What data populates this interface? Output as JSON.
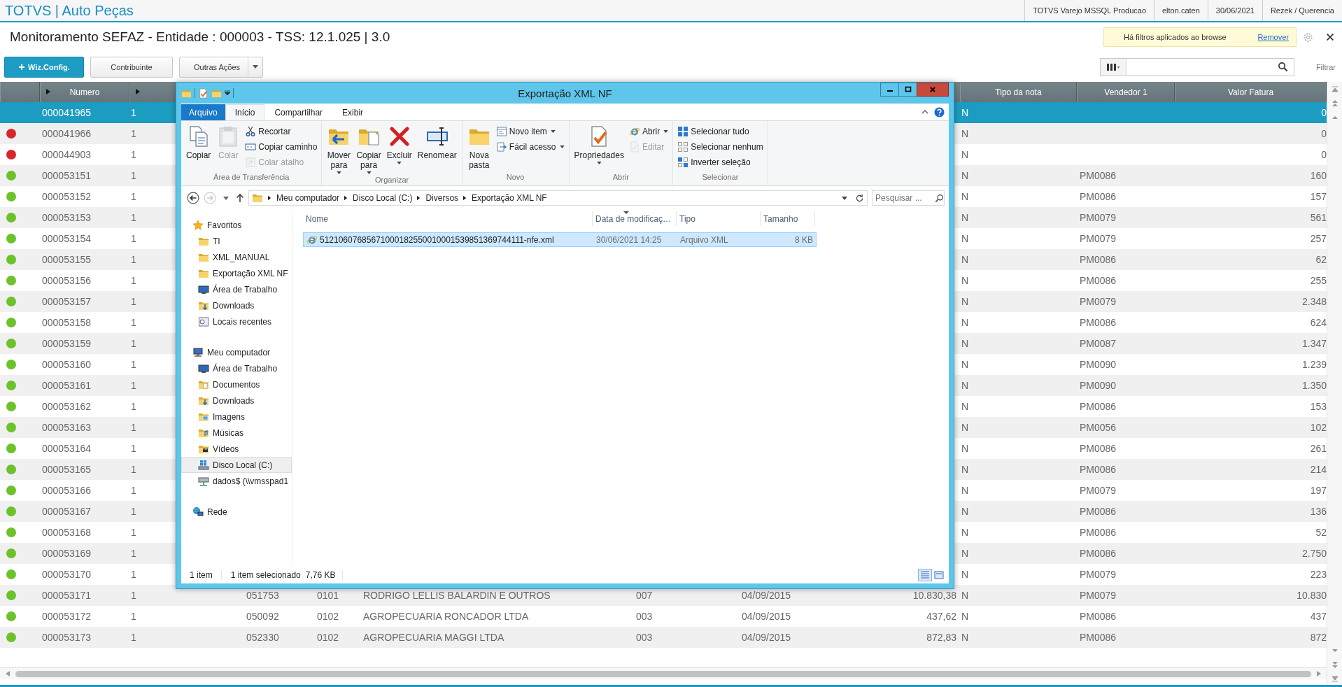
{
  "app": {
    "title": "TOTVS | Auto Peças",
    "status_items": [
      "TOTVS Varejo MSSQL Producao",
      "elton.caten",
      "30/06/2021",
      "Rezek / Querencia"
    ]
  },
  "page": {
    "title": "Monitoramento SEFAZ - Entidade : 000003 - TSS: 12.1.025 | 3.0",
    "filter_notice": {
      "text": "Há filtros aplicados ao browse",
      "link": "Remover"
    }
  },
  "toolbar": {
    "buttons": [
      {
        "label": "Wiz.Config.",
        "kind": "primary"
      },
      {
        "label": "Contribuinte",
        "kind": "plain"
      },
      {
        "label": "Outras Ações",
        "kind": "menu"
      }
    ],
    "filter_label": "Filtrar"
  },
  "table": {
    "columns": [
      {
        "label": "Numero"
      },
      {
        "label": "Tipo da nota"
      },
      {
        "label": "Vendedor 1"
      },
      {
        "label": "Valor Fatura"
      }
    ],
    "rows": [
      {
        "selected": true,
        "numero": "000041965",
        "column_3": "1",
        "tipo_da_nota": "N",
        "valor_fatura": "0"
      },
      {
        "selected": false,
        "color": "#d8262c",
        "numero": "000041966",
        "column_3": "1",
        "tipo_da_nota": "N",
        "valor_fatura": "0"
      },
      {
        "selected": false,
        "color": "#d8262c",
        "numero": "000044903",
        "column_3": "1",
        "tipo_da_nota": "N",
        "valor_fatura": "0"
      },
      {
        "selected": false,
        "color": "#6cc22a",
        "numero": "000053151",
        "column_3": "1",
        "tipo_da_nota": "N",
        "vendedor_1": "PM0086",
        "valor_fatura": "160"
      },
      {
        "selected": false,
        "color": "#6cc22a",
        "numero": "000053152",
        "column_3": "1",
        "tipo_da_nota": "N",
        "vendedor_1": "PM0086",
        "valor_fatura": "157"
      },
      {
        "selected": false,
        "color": "#6cc22a",
        "numero": "000053153",
        "column_3": "1",
        "tipo_da_nota": "N",
        "vendedor_1": "PM0079",
        "valor_fatura": "561"
      },
      {
        "selected": false,
        "color": "#6cc22a",
        "numero": "000053154",
        "column_3": "1",
        "tipo_da_nota": "N",
        "vendedor_1": "PM0079",
        "valor_fatura": "257"
      },
      {
        "selected": false,
        "color": "#6cc22a",
        "numero": "000053155",
        "column_3": "1",
        "tipo_da_nota": "N",
        "vendedor_1": "PM0086",
        "valor_fatura": "62"
      },
      {
        "selected": false,
        "color": "#6cc22a",
        "numero": "000053156",
        "column_3": "1",
        "tipo_da_nota": "N",
        "vendedor_1": "PM0086",
        "valor_fatura": "255"
      },
      {
        "selected": false,
        "color": "#6cc22a",
        "numero": "000053157",
        "column_3": "1",
        "tipo_da_nota": "N",
        "vendedor_1": "PM0079",
        "valor_fatura": "2.348"
      },
      {
        "selected": false,
        "color": "#6cc22a",
        "numero": "000053158",
        "column_3": "1",
        "tipo_da_nota": "N",
        "vendedor_1": "PM0086",
        "valor_fatura": "624"
      },
      {
        "selected": false,
        "color": "#6cc22a",
        "numero": "000053159",
        "column_3": "1",
        "tipo_da_nota": "N",
        "vendedor_1": "PM0087",
        "valor_fatura": "1.347"
      },
      {
        "selected": false,
        "color": "#6cc22a",
        "numero": "000053160",
        "column_3": "1",
        "tipo_da_nota": "N",
        "vendedor_1": "PM0090",
        "valor_fatura": "1.239"
      },
      {
        "selected": false,
        "color": "#6cc22a",
        "numero": "000053161",
        "column_3": "1",
        "tipo_da_nota": "N",
        "vendedor_1": "PM0090",
        "valor_fatura": "1.350"
      },
      {
        "selected": false,
        "color": "#6cc22a",
        "numero": "000053162",
        "column_3": "1",
        "tipo_da_nota": "N",
        "vendedor_1": "PM0086",
        "valor_fatura": "153"
      },
      {
        "selected": false,
        "color": "#6cc22a",
        "numero": "000053163",
        "column_3": "1",
        "tipo_da_nota": "N",
        "vendedor_1": "PM0056",
        "valor_fatura": "102"
      },
      {
        "selected": false,
        "color": "#6cc22a",
        "numero": "000053164",
        "column_3": "1",
        "tipo_da_nota": "N",
        "vendedor_1": "PM0086",
        "valor_fatura": "261"
      },
      {
        "selected": false,
        "color": "#6cc22a",
        "numero": "000053165",
        "column_3": "1",
        "tipo_da_nota": "N",
        "vendedor_1": "PM0086",
        "valor_fatura": "214"
      },
      {
        "selected": false,
        "color": "#6cc22a",
        "numero": "000053166",
        "column_3": "1",
        "tipo_da_nota": "N",
        "vendedor_1": "PM0079",
        "valor_fatura": "197"
      },
      {
        "selected": false,
        "color": "#6cc22a",
        "numero": "000053167",
        "column_3": "1",
        "tipo_da_nota": "N",
        "vendedor_1": "PM0086",
        "valor_fatura": "136"
      },
      {
        "selected": false,
        "color": "#6cc22a",
        "numero": "000053168",
        "column_3": "1",
        "tipo_da_nota": "N",
        "vendedor_1": "PM0086",
        "valor_fatura": "52"
      },
      {
        "selected": false,
        "color": "#6cc22a",
        "numero": "000053169",
        "column_3": "1",
        "tipo_da_nota": "N",
        "vendedor_1": "PM0086",
        "valor_fatura": "2.750"
      },
      {
        "selected": false,
        "color": "#6cc22a",
        "numero": "000053170",
        "column_3": "1",
        "tipo_da_nota": "N",
        "vendedor_1": "PM0079",
        "valor_fatura": "223"
      },
      {
        "selected": false,
        "color": "#6cc22a",
        "numero": "000053171",
        "column_3": "1",
        "column_4": "051753",
        "column_5": "0101",
        "column_6": "RODRIGO LELLIS BALARDIN E OUTROS",
        "column_7": "007",
        "column_8": "04/09/2015",
        "column_9": "10.830,38",
        "tipo_da_nota": "N",
        "vendedor_1": "PM0079",
        "valor_fatura": "10.830"
      },
      {
        "selected": false,
        "color": "#6cc22a",
        "numero": "000053172",
        "column_3": "1",
        "column_4": "050092",
        "column_5": "0102",
        "column_6": "AGROPECUARIA RONCADOR LTDA",
        "column_7": "003",
        "column_8": "04/09/2015",
        "column_9": "437,62",
        "tipo_da_nota": "N",
        "vendedor_1": "PM0086",
        "valor_fatura": "437"
      },
      {
        "selected": false,
        "color": "#6cc22a",
        "numero": "000053173",
        "column_3": "1",
        "column_4": "052330",
        "column_5": "0102",
        "column_6": "AGROPECUARIA MAGGI LTDA",
        "column_7": "003",
        "column_8": "04/09/2015",
        "column_9": "872,83",
        "tipo_da_nota": "N",
        "vendedor_1": "PM0086",
        "valor_fatura": "872"
      }
    ]
  },
  "explorer": {
    "title": "Exportação XML NF",
    "ribbon_tabs": [
      {
        "label": "Arquivo",
        "kind": "file",
        "selected": false
      },
      {
        "label": "Início",
        "kind": "tab",
        "selected": true
      },
      {
        "label": "Compartilhar",
        "kind": "tab",
        "selected": false
      },
      {
        "label": "Exibir",
        "kind": "tab",
        "selected": false
      }
    ],
    "ribbon_groups": [
      {
        "label": "Área de Transferência",
        "buttons": [
          {
            "label": "Copiar",
            "kind": "large",
            "disabled": false,
            "dropdown": false
          },
          {
            "label": "Colar",
            "kind": "large",
            "disabled": true,
            "dropdown": false
          },
          {
            "label": "Recortar",
            "kind": "small",
            "disabled": false,
            "dropdown": false
          },
          {
            "label": "Copiar caminho",
            "kind": "small",
            "disabled": false,
            "dropdown": false
          },
          {
            "label": "Colar atalho",
            "kind": "small",
            "disabled": true,
            "dropdown": false
          }
        ]
      },
      {
        "label": "Organizar",
        "buttons": [
          {
            "label": "Mover para",
            "kind": "large",
            "disabled": false,
            "dropdown": true
          },
          {
            "label": "Copiar para",
            "kind": "large",
            "disabled": false,
            "dropdown": true
          },
          {
            "label": "Excluir",
            "kind": "large",
            "disabled": false,
            "dropdown": true
          },
          {
            "label": "Renomear",
            "kind": "large",
            "disabled": false,
            "dropdown": false
          }
        ]
      },
      {
        "label": "Novo",
        "buttons": [
          {
            "label": "Nova pasta",
            "kind": "large",
            "disabled": false,
            "dropdown": false
          },
          {
            "label": "Novo item",
            "kind": "small",
            "disabled": false,
            "dropdown": true
          },
          {
            "label": "Fácil acesso",
            "kind": "small",
            "disabled": false,
            "dropdown": true
          }
        ]
      },
      {
        "label": "Abrir",
        "buttons": [
          {
            "label": "Propriedades",
            "kind": "large",
            "disabled": false,
            "dropdown": true
          },
          {
            "label": "Abrir",
            "kind": "small",
            "disabled": false,
            "dropdown": true
          },
          {
            "label": "Editar",
            "kind": "small",
            "disabled": true,
            "dropdown": false
          }
        ]
      },
      {
        "label": "Selecionar",
        "buttons": [
          {
            "label": "Selecionar tudo",
            "kind": "small",
            "disabled": false,
            "dropdown": false
          },
          {
            "label": "Selecionar nenhum",
            "kind": "small",
            "disabled": false,
            "dropdown": false
          },
          {
            "label": "Inverter seleção",
            "kind": "small",
            "disabled": false,
            "dropdown": false
          }
        ]
      }
    ],
    "address": {
      "crumbs": [
        "Meu computador",
        "Disco Local (C:)",
        "Diversos",
        "Exportação XML NF"
      ]
    },
    "search": {
      "placeholder": "Pesquisar ..."
    },
    "nav": [
      {
        "label": "Favoritos",
        "selected": false,
        "children": [
          {
            "label": "TI",
            "selected": false
          },
          {
            "label": "XML_MANUAL",
            "selected": false
          },
          {
            "label": "Exportação XML NF",
            "selected": false
          },
          {
            "label": "Área de Trabalho",
            "selected": false
          },
          {
            "label": "Downloads",
            "selected": false
          },
          {
            "label": "Locais recentes",
            "selected": false
          }
        ]
      },
      {
        "label": "Meu computador",
        "selected": false,
        "children": [
          {
            "label": "Área de Trabalho",
            "selected": false
          },
          {
            "label": "Documentos",
            "selected": false
          },
          {
            "label": "Downloads",
            "selected": false
          },
          {
            "label": "Imagens",
            "selected": false
          },
          {
            "label": "Músicas",
            "selected": false
          },
          {
            "label": "Vídeos",
            "selected": false
          },
          {
            "label": "Disco Local (C:)",
            "selected": true
          },
          {
            "label": "dados$ (\\\\vmsspad1",
            "selected": false
          }
        ]
      },
      {
        "label": "Rede",
        "selected": false
      }
    ],
    "files": {
      "columns": [
        "Nome",
        "Data de modificaç…",
        "Tipo",
        "Tamanho"
      ],
      "rows": [
        {
          "name": "51210607685671000182550010001539851369744111-nfe.xml",
          "modified": "30/06/2021 14:25",
          "type": "Arquivo XML",
          "size": "8 KB",
          "selected": true
        }
      ]
    },
    "status": {
      "count": "1 item",
      "selection": "1 item selecionado",
      "size": "7,76 KB"
    }
  }
}
